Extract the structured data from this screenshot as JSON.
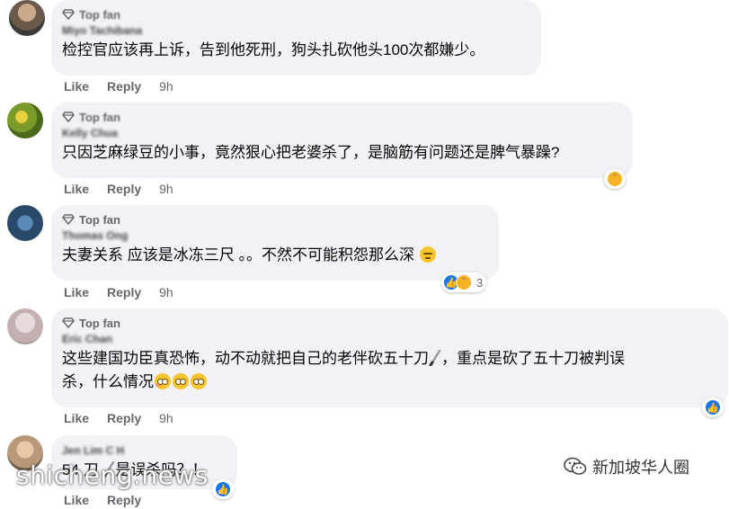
{
  "comments": [
    {
      "badge": "Top fan",
      "name": "Miyo Tachibana",
      "text": "检控官应该再上诉，告到他死刑，狗头扎砍他头100次都嫌少。",
      "like": "Like",
      "reply": "Reply",
      "time": "9h",
      "avatar_color": "#8a7a6a"
    },
    {
      "badge": "Top fan",
      "name": "Kelly Chua",
      "text": "只因芝麻绿豆的小事，竟然狠心把老婆杀了，是脑筋有问题还是脾气暴躁?",
      "like": "Like",
      "reply": "Reply",
      "time": "9h",
      "avatar_color": "#9aa83a"
    },
    {
      "badge": "Top fan",
      "name": "Thomas Ong",
      "text": "夫妻关系 应该是冰冻三尺 。。不然不可能积怨那么深",
      "like": "Like",
      "reply": "Reply",
      "time": "9h",
      "reaction_count": "3",
      "avatar_color": "#3a6a9a"
    },
    {
      "badge": "Top fan",
      "name": "Eric Chan",
      "text_line1": "这些建国功臣真恐怖，动不动就把自己的老伴砍五十刀",
      "text_line1b": "，重点是砍了五十刀被判误",
      "text_line2": "杀，什么情况",
      "like": "Like",
      "reply": "Reply",
      "time": "9h",
      "avatar_color": "#c8b8b8"
    },
    {
      "name": "Jen Lim C H",
      "text_a": "54 刀",
      "text_b": "是误杀吗？！",
      "like": "Like",
      "reply": "Reply",
      "avatar_color": "#b89878"
    }
  ],
  "watermark": "shicheng.news",
  "wechat_label": "新加坡华人圈",
  "colors": {
    "bubble": "#f0f2f5",
    "like_blue": "#1877f2",
    "meta_gray": "#65676b"
  }
}
